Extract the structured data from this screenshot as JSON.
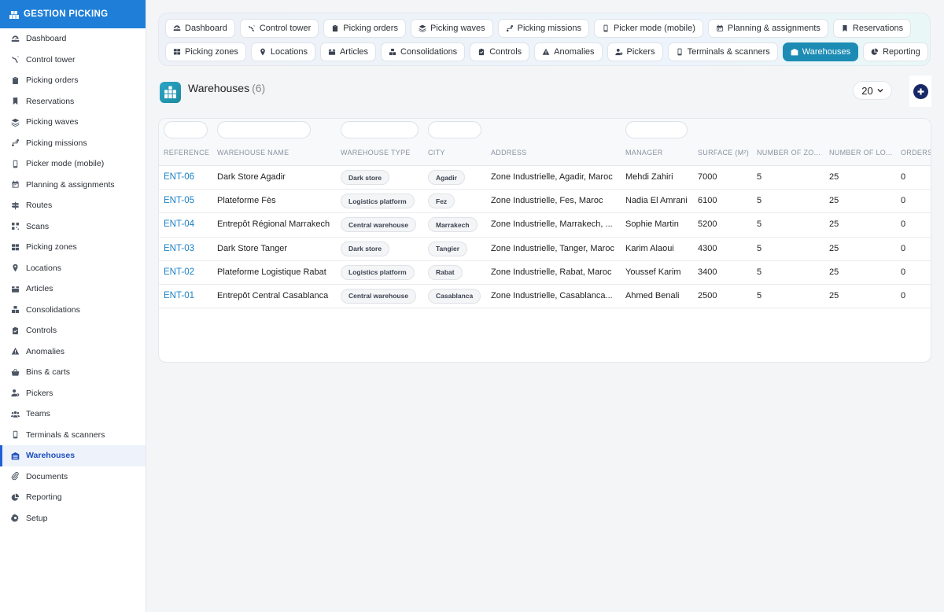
{
  "app": {
    "brand": "GESTION PICKING"
  },
  "sidebar": {
    "items": [
      {
        "label": "Dashboard",
        "icon": "dashboard-icon"
      },
      {
        "label": "Control tower",
        "icon": "satellite-icon"
      },
      {
        "label": "Picking orders",
        "icon": "clipboard-icon"
      },
      {
        "label": "Reservations",
        "icon": "bookmark-icon"
      },
      {
        "label": "Picking waves",
        "icon": "layers-icon"
      },
      {
        "label": "Picking missions",
        "icon": "route-icon"
      },
      {
        "label": "Picker mode (mobile)",
        "icon": "mobile-icon"
      },
      {
        "label": "Planning & assignments",
        "icon": "calendar-icon"
      },
      {
        "label": "Routes",
        "icon": "signpost-icon"
      },
      {
        "label": "Scans",
        "icon": "qrcode-icon"
      },
      {
        "label": "Picking zones",
        "icon": "grid-icon"
      },
      {
        "label": "Locations",
        "icon": "map-pin-icon"
      },
      {
        "label": "Articles",
        "icon": "box-icon"
      },
      {
        "label": "Consolidations",
        "icon": "boxes-icon"
      },
      {
        "label": "Controls",
        "icon": "clipboard-check-icon"
      },
      {
        "label": "Anomalies",
        "icon": "warning-icon"
      },
      {
        "label": "Bins & carts",
        "icon": "basket-icon"
      },
      {
        "label": "Pickers",
        "icon": "user-gear-icon"
      },
      {
        "label": "Teams",
        "icon": "users-icon"
      },
      {
        "label": "Terminals & scanners",
        "icon": "mobile-icon"
      },
      {
        "label": "Warehouses",
        "icon": "warehouse-icon",
        "active": true
      },
      {
        "label": "Documents",
        "icon": "paperclip-icon"
      },
      {
        "label": "Reporting",
        "icon": "pie-chart-icon"
      },
      {
        "label": "Setup",
        "icon": "gear-icon"
      }
    ]
  },
  "tabs": {
    "row1": [
      {
        "label": "Dashboard",
        "icon": "dashboard-icon"
      },
      {
        "label": "Control tower",
        "icon": "satellite-icon"
      },
      {
        "label": "Picking orders",
        "icon": "clipboard-icon"
      },
      {
        "label": "Picking waves",
        "icon": "layers-icon"
      },
      {
        "label": "Picking missions",
        "icon": "route-icon"
      },
      {
        "label": "Picker mode (mobile)",
        "icon": "mobile-icon"
      },
      {
        "label": "Planning & assignments",
        "icon": "calendar-icon"
      },
      {
        "label": "Reservations",
        "icon": "bookmark-icon"
      }
    ],
    "row2": [
      {
        "label": "Picking zones",
        "icon": "grid-icon"
      },
      {
        "label": "Locations",
        "icon": "map-pin-icon"
      },
      {
        "label": "Articles",
        "icon": "box-icon"
      },
      {
        "label": "Consolidations",
        "icon": "boxes-icon"
      },
      {
        "label": "Controls",
        "icon": "clipboard-check-icon"
      },
      {
        "label": "Anomalies",
        "icon": "warning-icon"
      },
      {
        "label": "Pickers",
        "icon": "user-gear-icon"
      },
      {
        "label": "Terminals & scanners",
        "icon": "mobile-icon"
      },
      {
        "label": "Warehouses",
        "icon": "warehouse-icon",
        "active": true
      },
      {
        "label": "Reporting",
        "icon": "pie-chart-icon"
      }
    ]
  },
  "page": {
    "title": "Warehouses",
    "count": "(6)",
    "per_page": "20"
  },
  "table": {
    "columns": [
      "Reference",
      "Warehouse name",
      "Warehouse type",
      "City",
      "Address",
      "Manager",
      "Surface (m²)",
      "Number of zo...",
      "Number of lo...",
      "Orders"
    ],
    "rows": [
      {
        "ref": "ENT-06",
        "name": "Dark Store Agadir",
        "type": "Dark store",
        "city": "Agadir",
        "address": "Zone Industrielle, Agadir, Maroc",
        "manager": "Mehdi Zahiri",
        "surface": "7000",
        "zones": "5",
        "locations": "25",
        "orders": "0"
      },
      {
        "ref": "ENT-05",
        "name": "Plateforme Fès",
        "type": "Logistics platform",
        "city": "Fez",
        "address": "Zone Industrielle, Fes, Maroc",
        "manager": "Nadia El Amrani",
        "surface": "6100",
        "zones": "5",
        "locations": "25",
        "orders": "0"
      },
      {
        "ref": "ENT-04",
        "name": "Entrepôt Régional Marrakech",
        "type": "Central warehouse",
        "city": "Marrakech",
        "address": "Zone Industrielle, Marrakech, ...",
        "manager": "Sophie Martin",
        "surface": "5200",
        "zones": "5",
        "locations": "25",
        "orders": "0"
      },
      {
        "ref": "ENT-03",
        "name": "Dark Store Tanger",
        "type": "Dark store",
        "city": "Tangier",
        "address": "Zone Industrielle, Tanger, Maroc",
        "manager": "Karim Alaoui",
        "surface": "4300",
        "zones": "5",
        "locations": "25",
        "orders": "0"
      },
      {
        "ref": "ENT-02",
        "name": "Plateforme Logistique Rabat",
        "type": "Logistics platform",
        "city": "Rabat",
        "address": "Zone Industrielle, Rabat, Maroc",
        "manager": "Youssef Karim",
        "surface": "3400",
        "zones": "5",
        "locations": "25",
        "orders": "0"
      },
      {
        "ref": "ENT-01",
        "name": "Entrepôt Central Casablanca",
        "type": "Central warehouse",
        "city": "Casablanca",
        "address": "Zone Industrielle, Casablanca...",
        "manager": "Ahmed Benali",
        "surface": "2500",
        "zones": "5",
        "locations": "25",
        "orders": "0"
      }
    ]
  },
  "colors": {
    "brand": "#1f7fd8",
    "active_tab": "#1d8cb5",
    "link": "#1a7fc4",
    "add_button": "#172866"
  }
}
